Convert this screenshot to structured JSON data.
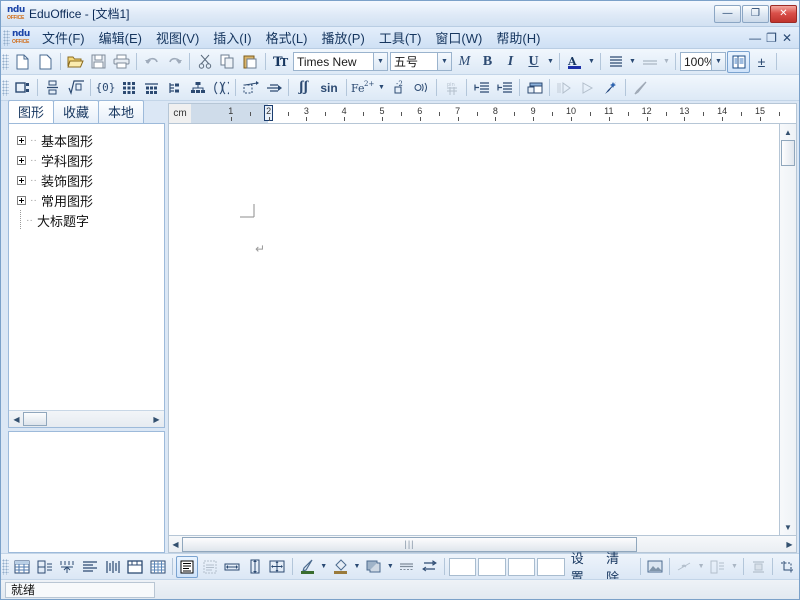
{
  "window": {
    "title": "EduOffice - [文档1]",
    "app_name": "EduOffice",
    "logo_top": "ndu",
    "logo_bottom": "OFFICE",
    "controls": {
      "minimize": "—",
      "maximize": "❐",
      "close": "✕"
    }
  },
  "menubar": {
    "items": [
      {
        "label": "文件(F)",
        "name": "file"
      },
      {
        "label": "编辑(E)",
        "name": "edit"
      },
      {
        "label": "视图(V)",
        "name": "view"
      },
      {
        "label": "插入(I)",
        "name": "insert"
      },
      {
        "label": "格式(L)",
        "name": "format"
      },
      {
        "label": "播放(P)",
        "name": "play"
      },
      {
        "label": "工具(T)",
        "name": "tools"
      },
      {
        "label": "窗口(W)",
        "name": "window"
      },
      {
        "label": "帮助(H)",
        "name": "help"
      }
    ],
    "doc_controls": {
      "minimize": "—",
      "restore": "❐",
      "close": "✕"
    }
  },
  "toolbar_main": {
    "font_name": "Times New ",
    "font_size": "五号",
    "zoom": "100%",
    "bold": "B",
    "italic": "I",
    "underline": "U",
    "font_style_m": "M",
    "plus_minus": "±",
    "icons": [
      "new-document-icon",
      "new-document-alt-icon",
      "open-folder-icon",
      "save-icon",
      "print-icon",
      "undo-icon",
      "redo-icon",
      "cut-icon",
      "copy-icon",
      "paste-icon",
      "font-icon",
      "text-color-icon",
      "align-icon",
      "line-style-icon",
      "columns-icon"
    ]
  },
  "toolbar_formula": {
    "sin_label": "sin",
    "fe_label": "Fe",
    "fe_sup": "2+",
    "ff_label": "ʃʃ",
    "brace_label": "{0}",
    "icons": [
      "object-icon",
      "fraction-icon",
      "radical-icon",
      "braces-icon",
      "matrix-icon",
      "matrix-bottom-icon",
      "tree-icon",
      "structure-icon",
      "parentheses-icon",
      "select-area-icon",
      "arrow-map-icon",
      "integral-icon",
      "trig-icon",
      "chemistry-icon",
      "superscript-icon",
      "sound-icon",
      "pinyin-icon",
      "indent-decrease-icon",
      "indent-increase-icon",
      "window-insert-icon",
      "play-all-icon",
      "play-icon",
      "magic-pen-icon",
      "pencil-icon"
    ]
  },
  "sidebar": {
    "tabs": [
      {
        "label": "图形",
        "active": true
      },
      {
        "label": "收藏",
        "active": false
      },
      {
        "label": "本地",
        "active": false
      }
    ],
    "tree": [
      {
        "label": "基本图形",
        "expandable": true
      },
      {
        "label": "学科图形",
        "expandable": true
      },
      {
        "label": "装饰图形",
        "expandable": true
      },
      {
        "label": "常用图形",
        "expandable": true
      },
      {
        "label": "大标题字",
        "expandable": false
      }
    ]
  },
  "ruler": {
    "unit": "cm",
    "ticks": [
      "1",
      "2",
      "3",
      "4",
      "5",
      "6",
      "7",
      "8",
      "9",
      "10",
      "11",
      "12",
      "13",
      "14",
      "15"
    ]
  },
  "document": {
    "paragraph_mark": "↵"
  },
  "toolbar_bottom": {
    "settings_label": "设置",
    "clear_label": "清除",
    "icons": [
      "insert-table-icon",
      "split-cells-icon",
      "merge-cells-icon",
      "distribute-rows-icon",
      "distribute-cols-icon",
      "table-border-icon",
      "table-grid-icon",
      "align-top-icon",
      "align-middle-icon",
      "width-icon",
      "height-icon",
      "autofit-icon",
      "pen-color-icon",
      "fill-color-icon",
      "shadow-icon",
      "border-style-icon",
      "line-spacing-icon",
      "image-icon",
      "link-icon",
      "layout-icon",
      "group-icon",
      "crop-icon"
    ],
    "swatch_count": 4
  },
  "statusbar": {
    "message": "就绪"
  }
}
